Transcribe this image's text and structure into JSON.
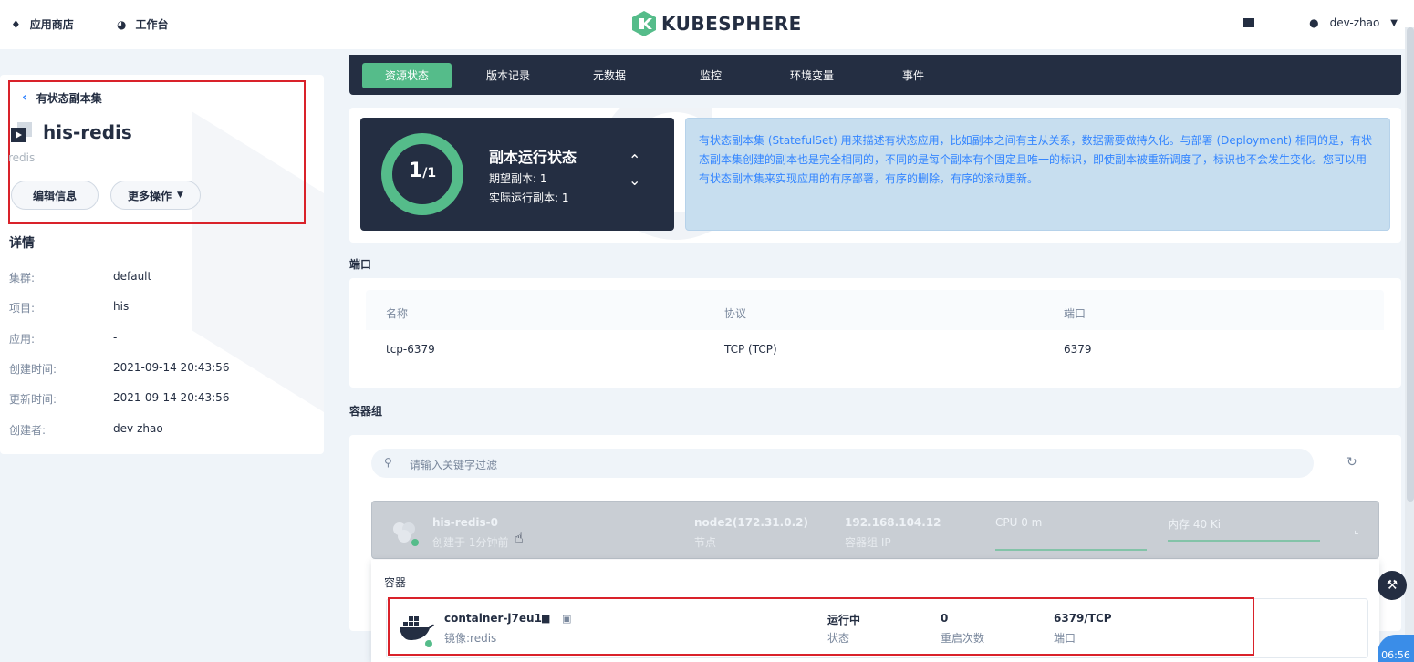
{
  "nav": {
    "app_store": "应用商店",
    "workbench": "工作台",
    "logo": "KUBESPHERE",
    "user": "dev-zhao"
  },
  "left": {
    "back": "有状态副本集",
    "name": "his-redis",
    "desc": "redis",
    "edit_btn": "编辑信息",
    "more_btn": "更多操作",
    "details_title": "详情",
    "details": [
      {
        "label": "集群:",
        "value": "default"
      },
      {
        "label": "项目:",
        "value": "his"
      },
      {
        "label": "应用:",
        "value": "-"
      },
      {
        "label": "创建时间:",
        "value": "2021-09-14 20:43:56"
      },
      {
        "label": "更新时间:",
        "value": "2021-09-14 20:43:56"
      },
      {
        "label": "创建者:",
        "value": "dev-zhao"
      }
    ]
  },
  "tabs": [
    "资源状态",
    "版本记录",
    "元数据",
    "监控",
    "环境变量",
    "事件"
  ],
  "status": {
    "ratio_main": "1",
    "ratio_sub": "/1",
    "title": "副本运行状态",
    "desired": "期望副本: 1",
    "running": "实际运行副本: 1",
    "info": "有状态副本集 (StatefulSet) 用来描述有状态应用，比如副本之间有主从关系，数据需要做持久化。与部署 (Deployment) 相同的是，有状态副本集创建的副本也是完全相同的，不同的是每个副本有个固定且唯一的标识，即使副本被重新调度了，标识也不会发生变化。您可以用有状态副本集来实现应用的有序部署，有序的删除，有序的滚动更新。"
  },
  "ports": {
    "title": "端口",
    "headers": [
      "名称",
      "协议",
      "端口"
    ],
    "row": [
      "tcp-6379",
      "TCP (TCP)",
      "6379"
    ]
  },
  "pods": {
    "title": "容器组",
    "search_placeholder": "请输入关键字过滤",
    "pod": {
      "name": "his-redis-0",
      "created": "创建于 1分钟前",
      "node": "node2(172.31.0.2)",
      "node_label": "节点",
      "ip": "192.168.104.12",
      "ip_label": "容器组 IP",
      "cpu": "CPU 0 m",
      "mem": "内存 40 Ki"
    },
    "containers_title": "容器",
    "container": {
      "name": "container-j7eu1z",
      "image": "镜像:redis",
      "status": "运行中",
      "status_label": "状态",
      "restarts": "0",
      "restarts_label": "重启次数",
      "port": "6379/TCP",
      "port_label": "端口"
    }
  },
  "clock": "06:56",
  "colors": {
    "accent": "#55bc8a",
    "dark": "#242e42",
    "highlight": "#d9222a"
  }
}
